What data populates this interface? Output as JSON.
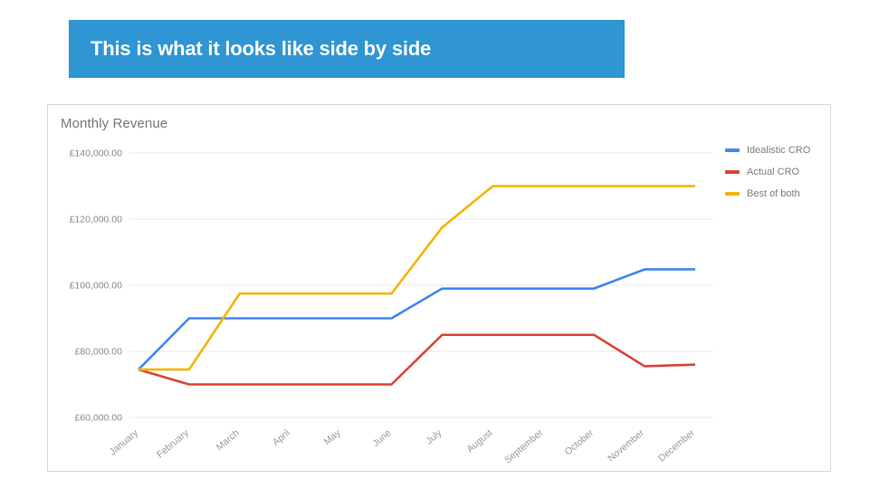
{
  "banner": {
    "title": "This is what it looks like side by side",
    "color": "#2f95d3"
  },
  "card": {
    "title": "Monthly Revenue"
  },
  "legend": {
    "items": [
      {
        "label": "Idealistic CRO",
        "color": "#4285f4"
      },
      {
        "label": "Actual CRO",
        "color": "#db4437"
      },
      {
        "label": "Best of both",
        "color": "#f4b400"
      }
    ]
  },
  "chart_data": {
    "type": "line",
    "title": "Monthly Revenue",
    "xlabel": "",
    "ylabel": "",
    "categories": [
      "January",
      "February",
      "March",
      "April",
      "May",
      "June",
      "July",
      "August",
      "September",
      "October",
      "November",
      "December"
    ],
    "ylim": [
      55000,
      145000
    ],
    "yticks": [
      60000,
      80000,
      100000,
      120000,
      140000
    ],
    "ytick_labels": [
      "£60,000.00",
      "£80,000.00",
      "£100,000.00",
      "£120,000.00",
      "£140,000.00"
    ],
    "currency_symbol": "£",
    "grid": true,
    "legend_position": "right",
    "series": [
      {
        "name": "Idealistic CRO",
        "color": "#4285f4",
        "values": [
          74500,
          90000,
          90000,
          90000,
          90000,
          90000,
          99000,
          99000,
          99000,
          99000,
          104800,
          104800
        ]
      },
      {
        "name": "Actual CRO",
        "color": "#db4437",
        "values": [
          74500,
          70000,
          70000,
          70000,
          70000,
          70000,
          85000,
          85000,
          85000,
          85000,
          75500,
          76000
        ]
      },
      {
        "name": "Best of both",
        "color": "#f4b400",
        "values": [
          74500,
          74500,
          97500,
          97500,
          97500,
          97500,
          117500,
          130000,
          130000,
          130000,
          130000,
          130000
        ]
      }
    ]
  }
}
